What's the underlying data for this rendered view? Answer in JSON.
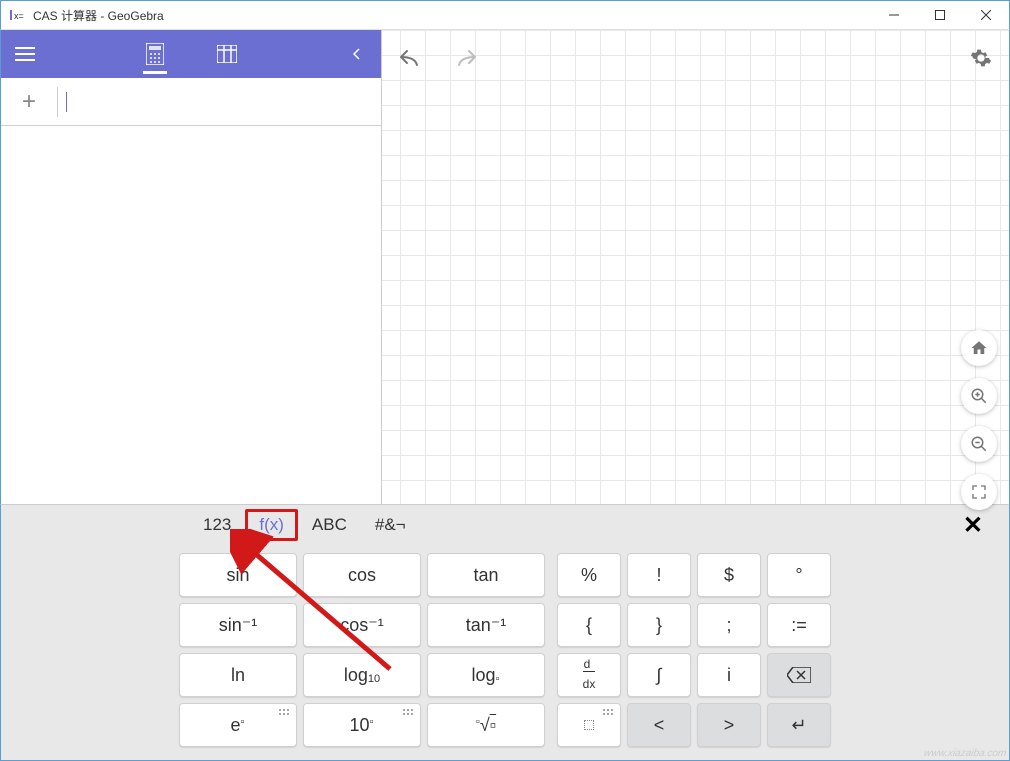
{
  "titlebar": {
    "title": "CAS 计算器 - GeoGebra"
  },
  "keyboard": {
    "tabs": {
      "t1": "123",
      "t2": "f(x)",
      "t3": "ABC",
      "t4": "#&¬"
    },
    "keys_left": {
      "r1": [
        "sin",
        "cos",
        "tan"
      ],
      "r2": [
        "sin⁻¹",
        "cos⁻¹",
        "tan⁻¹"
      ],
      "r3_0": "ln"
    },
    "keys_right": {
      "r1": [
        "%",
        "!",
        "$",
        "°"
      ],
      "r2": [
        "{",
        "}",
        ";",
        ":="
      ],
      "r3_1": "∫",
      "r3_2": "i",
      "r4_1": "<",
      "r4_2": ">",
      "r4_3": "↵"
    }
  },
  "watermark": "www.xiazaiba.com"
}
